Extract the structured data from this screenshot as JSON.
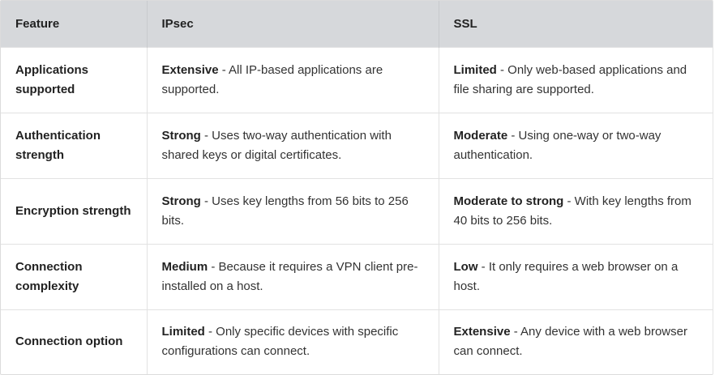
{
  "header": {
    "feature": "Feature",
    "ipsec": "IPsec",
    "ssl": "SSL"
  },
  "rows": [
    {
      "feature": "Applications supported",
      "ipsec_level": "Extensive",
      "ipsec_desc": " - All IP-based applications are supported.",
      "ssl_level": "Limited",
      "ssl_desc": " - Only web-based applications and file sharing are supported."
    },
    {
      "feature": "Authentication strength",
      "ipsec_level": "Strong",
      "ipsec_desc": " - Uses two-way authentication with shared keys or digital certificates.",
      "ssl_level": "Moderate",
      "ssl_desc": " - Using one-way or two-way authentication."
    },
    {
      "feature": "Encryption strength",
      "ipsec_level": "Strong",
      "ipsec_desc": " - Uses key lengths from 56 bits to 256 bits.",
      "ssl_level": "Moderate to strong",
      "ssl_desc": " - With key lengths from 40 bits to 256 bits."
    },
    {
      "feature": "Connection complexity",
      "ipsec_level": "Medium",
      "ipsec_desc": " - Because it requires a VPN client pre-installed on a host.",
      "ssl_level": "Low",
      "ssl_desc": " - It only requires a web browser on a host."
    },
    {
      "feature": "Connection option",
      "ipsec_level": "Limited",
      "ipsec_desc": " - Only specific devices with specific configurations can connect.",
      "ssl_level": "Extensive",
      "ssl_desc": " - Any device with a web browser can connect."
    }
  ]
}
